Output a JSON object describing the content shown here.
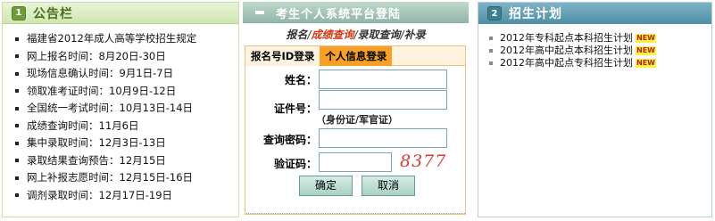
{
  "announcements": {
    "badge": "1",
    "title": "公告栏",
    "items": [
      "福建省2012年成人高等学校招生规定",
      "网上报名时间：8月20日-30日",
      "现场信息确认时间：9月1日-7日",
      "领取准考证时间：10月9日-12日",
      "全国统一考试时间：10月13日-14日",
      "成绩查询时间：11月6日",
      "集中录取时间：12月3日-13日",
      "录取结果查询预告：12月15日",
      "网上补报志愿时间：12月15日-16日",
      "调剂录取时间：12月17日-19日"
    ]
  },
  "login": {
    "title": "考生个人系统平台登陆",
    "links": {
      "l1": "报名",
      "l2": "成绩查询",
      "l3": "录取查询",
      "l4": "补录",
      "sep": "/"
    },
    "tabs": {
      "tab1": "报名号ID登录",
      "tab2": "个人信息登录"
    },
    "fields": {
      "name_label": "姓名：",
      "id_label": "证件号：",
      "id_hint": "（身份证/军官证）",
      "pwd_label": "查询密码：",
      "captcha_label": "验证码：",
      "captcha_value": "8377"
    },
    "buttons": {
      "confirm": "确定",
      "cancel": "取消"
    }
  },
  "plans": {
    "badge": "2",
    "title": "招生计划",
    "new_label": "NEW",
    "items": [
      "2012年专科起点本科招生计划",
      "2012年高中起点本科招生计划",
      "2012年高中起点专科招生计划"
    ]
  },
  "colors": {
    "accent_orange": "#f7a028",
    "link_red": "#d03a14",
    "captcha_red": "#d83a3a",
    "green_header": "#cfe6b0",
    "teal_header": "#4e8fa6"
  }
}
